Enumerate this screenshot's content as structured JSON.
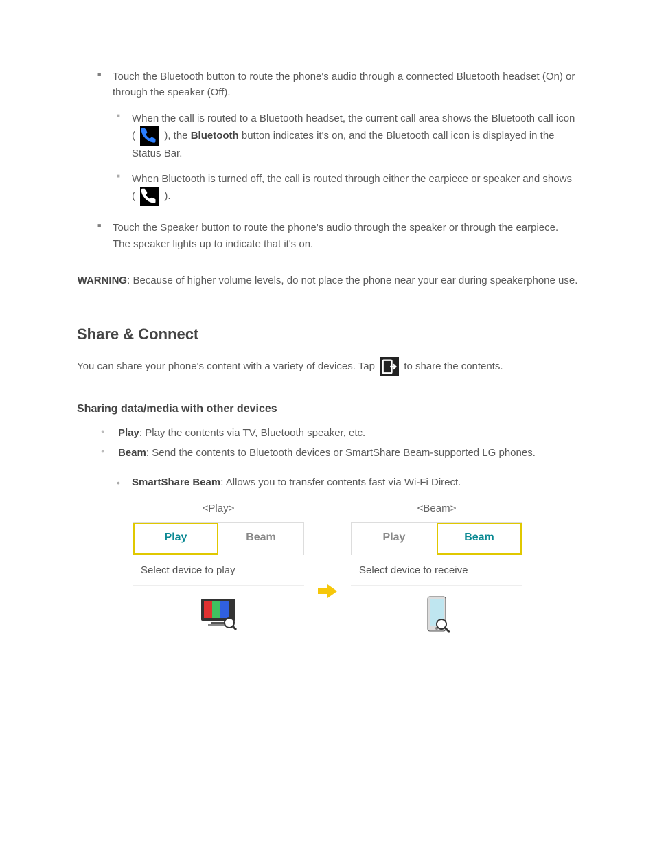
{
  "section1": {
    "item1": {
      "text_prefix": "Touch the Bluetooth button to route the phone's audio through a connected Bluetooth headset (On) or through the speaker (Off).",
      "sub1": {
        "prefix": "When the call is routed to a Bluetooth headset, the current call area shows the Bluetooth call icon (",
        "middle": "), the ",
        "bold": "Bluetooth",
        "after_bold": " button indicates it's on, and the",
        "tail": " Bluetooth call icon is displayed in the Status Bar."
      },
      "sub2": {
        "prefix": "When Bluetooth is turned off, the call is routed through either the earpiece or speaker and shows (",
        "tail": ")."
      }
    },
    "item2": "Touch the Speaker button to route the phone's audio through the speaker or through the earpiece. The speaker lights up to indicate that it's on."
  },
  "warning": {
    "label": "WARNING",
    "text": ": Because of higher volume levels, do not place the phone near your ear during speakerphone use."
  },
  "section2": {
    "title": "Share & Connect",
    "intro_prefix": "You can share your phone's content with a variety of devices. Tap ",
    "intro_suffix": " to share the contents.",
    "sharing_data_title": "Sharing data/media with other devices",
    "bullet_play_bold": "Play",
    "bullet_play_text": ": Play the contents via TV, Bluetooth speaker, etc.",
    "bullet_beam_bold": "Beam",
    "bullet_beam_text": ": Send the contents to Bluetooth devices or SmartShare Beam-supported LG phones.",
    "sub_note_bold": "SmartShare Beam",
    "sub_note_text": ": Allows you to transfer contents fast via Wi-Fi Direct."
  },
  "figure": {
    "left_title": "<Play>",
    "right_title": "<Beam>",
    "tab_play": "Play",
    "tab_beam": "Beam",
    "left_subtext": "Select device to play",
    "right_subtext": "Select device to receive"
  }
}
